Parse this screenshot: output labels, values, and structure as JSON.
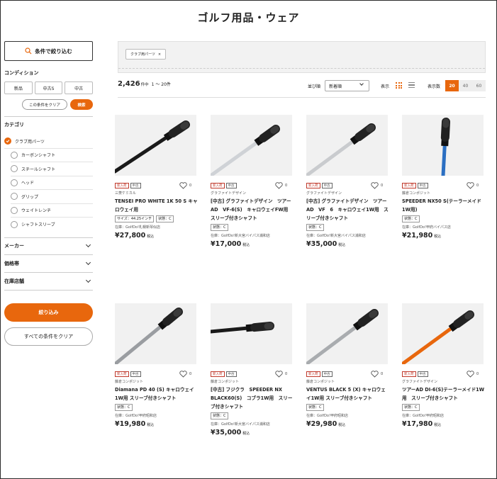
{
  "page_title": "ゴルフ用品・ウェア",
  "sidebar": {
    "condition_button": "条件で絞り込む",
    "condition_label": "コンディション",
    "condition_options": [
      "新品",
      "中古S",
      "中古"
    ],
    "clear_this": "この条件をクリア",
    "search": "検索",
    "category_label": "カテゴリ",
    "category_selected": "クラブ用パーツ",
    "category_subs": [
      "カーボンシャフト",
      "スチールシャフト",
      "ヘッド",
      "グリップ",
      "ウェイトレンチ",
      "シャフトスリーブ"
    ],
    "accordions": [
      "メーカー",
      "価格帯",
      "在庫店舗"
    ],
    "narrow_button": "絞り込み",
    "clear_all": "すべての条件をクリア"
  },
  "filter_chip": {
    "label": "クラブ用パーツ",
    "close": "×"
  },
  "toolbar": {
    "count": "2,426",
    "count_unit": "件中",
    "range": "1 〜 20件",
    "sort_label": "並び順",
    "sort_value": "新着順",
    "display_label": "表示",
    "per_page_label": "表示数",
    "per_page_options": [
      "20",
      "40",
      "60"
    ],
    "per_page_selected": "20"
  },
  "accent_color": "#e8670d",
  "products": [
    {
      "badges": [
        "新入荷",
        "中古"
      ],
      "fav": "0",
      "maker": "三菱ケミカル",
      "name": "TENSEI PRO WHITE 1K 50 S キャロウェイ用",
      "tags": [
        "サイズ：44.25インチ",
        "状態：C"
      ],
      "stock": "在庫：GolfDo!札幌新琴似店",
      "price": "¥27,800",
      "tax": "税込"
    },
    {
      "badges": [
        "新入荷",
        "中古"
      ],
      "fav": "0",
      "maker": "グラファイトデザイン",
      "name": "[中古] グラファイトデザイン　ツアーAD　VF-6(S)　キャロウェイFW用　スリーブ付きシャフト",
      "tags": [
        "状態：C"
      ],
      "stock": "在庫：GolfDo!新大宮バイパス浦和店",
      "price": "¥17,000",
      "tax": "税込"
    },
    {
      "badges": [
        "新入荷",
        "中古"
      ],
      "fav": "0",
      "maker": "グラファイトデザイン",
      "name": "[中古] グラファイトデザイン　ツアーAD　VF　6　キャロウェイ1W用　スリーブ付きシャフト",
      "tags": [
        "状態：C"
      ],
      "stock": "在庫：GolfDo!新大宮バイパス浦和店",
      "price": "¥35,000",
      "tax": "税込"
    },
    {
      "badges": [
        "新入荷",
        "中古"
      ],
      "fav": "0",
      "maker": "藤倉コンポジット",
      "name": "SPEEDER NX50 S(テーラーメイド1W用)",
      "tags": [
        "状態：C"
      ],
      "stock": "在庫：GolfDo!甲府バイパス店",
      "price": "¥21,980",
      "tax": "税込"
    },
    {
      "badges": [
        "新入荷",
        "中古"
      ],
      "fav": "0",
      "maker": "藤倉コンポジット",
      "name": "Diamana PD 40 (S) キャロウェイ1W用 スリーブ付きシャフト",
      "tags": [
        "状態：C"
      ],
      "stock": "在庫：GolfDo!甲府昭和店",
      "price": "¥19,980",
      "tax": "税込"
    },
    {
      "badges": [
        "新入荷",
        "中古"
      ],
      "fav": "0",
      "maker": "藤倉コンポジット",
      "name": "[中古] フジクラ　SPEEDER NX BLACK60(S)　コブラ1W用　スリーブ付きシャフト",
      "tags": [
        "状態：C"
      ],
      "stock": "在庫：GolfDo!新大宮バイパス浦和店",
      "price": "¥35,000",
      "tax": "税込"
    },
    {
      "badges": [
        "新入荷",
        "中古"
      ],
      "fav": "0",
      "maker": "藤倉コンポジット",
      "name": "VENTUS BLACK 5 (X) キャロウェイ1W用 スリーブ付きシャフト",
      "tags": [
        "状態：C"
      ],
      "stock": "在庫：GolfDo!甲府昭和店",
      "price": "¥29,980",
      "tax": "税込"
    },
    {
      "badges": [
        "新入荷",
        "中古"
      ],
      "fav": "0",
      "maker": "グラファイトデザイン",
      "name": "ツアーAD DI-6(S)テーラーメイド1W用　スリーブ付きシャフト",
      "tags": [
        "状態：C"
      ],
      "stock": "在庫：GolfDo!甲府昭和店",
      "price": "¥17,980",
      "tax": "税込"
    }
  ]
}
